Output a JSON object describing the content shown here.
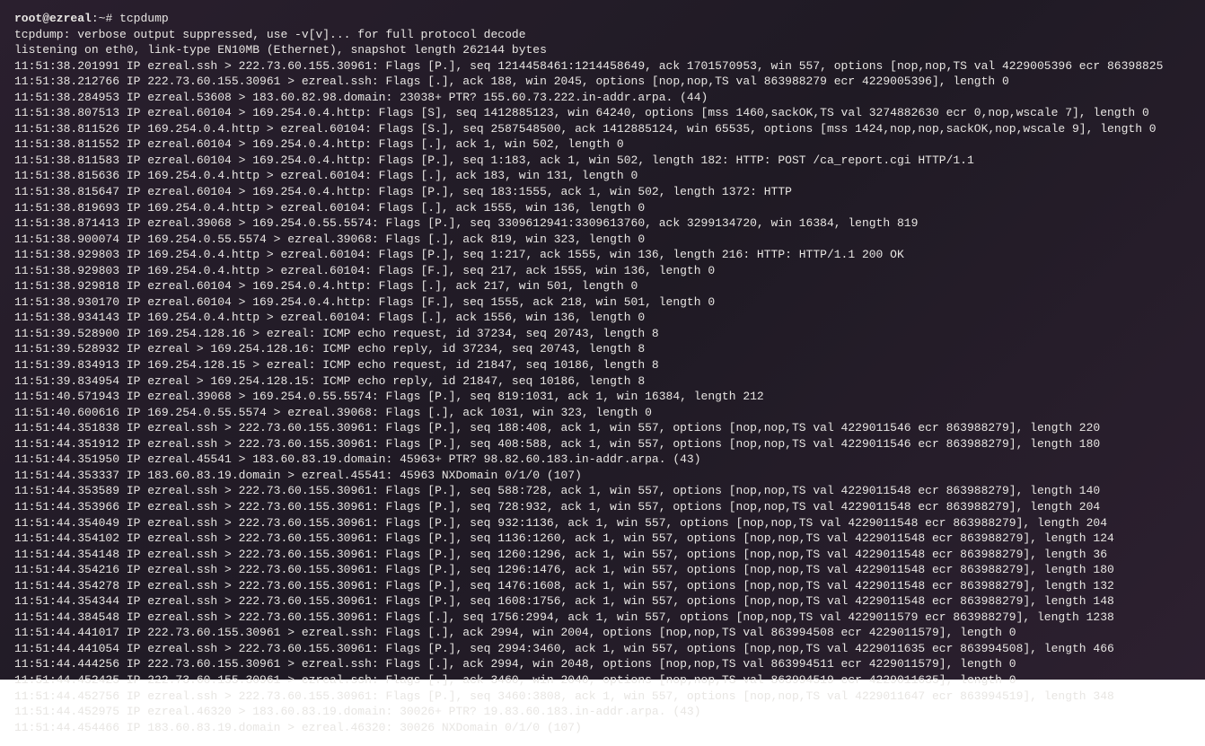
{
  "prompt": {
    "user_host": "root@ezreal",
    "separator": ":",
    "path": "~",
    "symbol": "#",
    "command": "tcpdump"
  },
  "lines": [
    "tcpdump: verbose output suppressed, use -v[v]... for full protocol decode",
    "listening on eth0, link-type EN10MB (Ethernet), snapshot length 262144 bytes",
    "11:51:38.201991 IP ezreal.ssh > 222.73.60.155.30961: Flags [P.], seq 1214458461:1214458649, ack 1701570953, win 557, options [nop,nop,TS val 4229005396 ecr 86398825",
    "11:51:38.212766 IP 222.73.60.155.30961 > ezreal.ssh: Flags [.], ack 188, win 2045, options [nop,nop,TS val 863988279 ecr 4229005396], length 0",
    "11:51:38.284953 IP ezreal.53608 > 183.60.82.98.domain: 23038+ PTR? 155.60.73.222.in-addr.arpa. (44)",
    "11:51:38.807513 IP ezreal.60104 > 169.254.0.4.http: Flags [S], seq 1412885123, win 64240, options [mss 1460,sackOK,TS val 3274882630 ecr 0,nop,wscale 7], length 0",
    "11:51:38.811526 IP 169.254.0.4.http > ezreal.60104: Flags [S.], seq 2587548500, ack 1412885124, win 65535, options [mss 1424,nop,nop,sackOK,nop,wscale 9], length 0",
    "11:51:38.811552 IP ezreal.60104 > 169.254.0.4.http: Flags [.], ack 1, win 502, length 0",
    "11:51:38.811583 IP ezreal.60104 > 169.254.0.4.http: Flags [P.], seq 1:183, ack 1, win 502, length 182: HTTP: POST /ca_report.cgi HTTP/1.1",
    "11:51:38.815636 IP 169.254.0.4.http > ezreal.60104: Flags [.], ack 183, win 131, length 0",
    "11:51:38.815647 IP ezreal.60104 > 169.254.0.4.http: Flags [P.], seq 183:1555, ack 1, win 502, length 1372: HTTP",
    "11:51:38.819693 IP 169.254.0.4.http > ezreal.60104: Flags [.], ack 1555, win 136, length 0",
    "11:51:38.871413 IP ezreal.39068 > 169.254.0.55.5574: Flags [P.], seq 3309612941:3309613760, ack 3299134720, win 16384, length 819",
    "11:51:38.900074 IP 169.254.0.55.5574 > ezreal.39068: Flags [.], ack 819, win 323, length 0",
    "11:51:38.929803 IP 169.254.0.4.http > ezreal.60104: Flags [P.], seq 1:217, ack 1555, win 136, length 216: HTTP: HTTP/1.1 200 OK",
    "11:51:38.929803 IP 169.254.0.4.http > ezreal.60104: Flags [F.], seq 217, ack 1555, win 136, length 0",
    "11:51:38.929818 IP ezreal.60104 > 169.254.0.4.http: Flags [.], ack 217, win 501, length 0",
    "11:51:38.930170 IP ezreal.60104 > 169.254.0.4.http: Flags [F.], seq 1555, ack 218, win 501, length 0",
    "11:51:38.934143 IP 169.254.0.4.http > ezreal.60104: Flags [.], ack 1556, win 136, length 0",
    "11:51:39.528900 IP 169.254.128.16 > ezreal: ICMP echo request, id 37234, seq 20743, length 8",
    "11:51:39.528932 IP ezreal > 169.254.128.16: ICMP echo reply, id 37234, seq 20743, length 8",
    "11:51:39.834913 IP 169.254.128.15 > ezreal: ICMP echo request, id 21847, seq 10186, length 8",
    "11:51:39.834954 IP ezreal > 169.254.128.15: ICMP echo reply, id 21847, seq 10186, length 8",
    "11:51:40.571943 IP ezreal.39068 > 169.254.0.55.5574: Flags [P.], seq 819:1031, ack 1, win 16384, length 212",
    "11:51:40.600616 IP 169.254.0.55.5574 > ezreal.39068: Flags [.], ack 1031, win 323, length 0",
    "11:51:44.351838 IP ezreal.ssh > 222.73.60.155.30961: Flags [P.], seq 188:408, ack 1, win 557, options [nop,nop,TS val 4229011546 ecr 863988279], length 220",
    "11:51:44.351912 IP ezreal.ssh > 222.73.60.155.30961: Flags [P.], seq 408:588, ack 1, win 557, options [nop,nop,TS val 4229011546 ecr 863988279], length 180",
    "11:51:44.351950 IP ezreal.45541 > 183.60.83.19.domain: 45963+ PTR? 98.82.60.183.in-addr.arpa. (43)",
    "11:51:44.353337 IP 183.60.83.19.domain > ezreal.45541: 45963 NXDomain 0/1/0 (107)",
    "11:51:44.353589 IP ezreal.ssh > 222.73.60.155.30961: Flags [P.], seq 588:728, ack 1, win 557, options [nop,nop,TS val 4229011548 ecr 863988279], length 140",
    "11:51:44.353966 IP ezreal.ssh > 222.73.60.155.30961: Flags [P.], seq 728:932, ack 1, win 557, options [nop,nop,TS val 4229011548 ecr 863988279], length 204",
    "11:51:44.354049 IP ezreal.ssh > 222.73.60.155.30961: Flags [P.], seq 932:1136, ack 1, win 557, options [nop,nop,TS val 4229011548 ecr 863988279], length 204",
    "11:51:44.354102 IP ezreal.ssh > 222.73.60.155.30961: Flags [P.], seq 1136:1260, ack 1, win 557, options [nop,nop,TS val 4229011548 ecr 863988279], length 124",
    "11:51:44.354148 IP ezreal.ssh > 222.73.60.155.30961: Flags [P.], seq 1260:1296, ack 1, win 557, options [nop,nop,TS val 4229011548 ecr 863988279], length 36",
    "11:51:44.354216 IP ezreal.ssh > 222.73.60.155.30961: Flags [P.], seq 1296:1476, ack 1, win 557, options [nop,nop,TS val 4229011548 ecr 863988279], length 180",
    "11:51:44.354278 IP ezreal.ssh > 222.73.60.155.30961: Flags [P.], seq 1476:1608, ack 1, win 557, options [nop,nop,TS val 4229011548 ecr 863988279], length 132",
    "11:51:44.354344 IP ezreal.ssh > 222.73.60.155.30961: Flags [P.], seq 1608:1756, ack 1, win 557, options [nop,nop,TS val 4229011548 ecr 863988279], length 148",
    "11:51:44.384548 IP ezreal.ssh > 222.73.60.155.30961: Flags [.], seq 1756:2994, ack 1, win 557, options [nop,nop,TS val 4229011579 ecr 863988279], length 1238",
    "11:51:44.441017 IP 222.73.60.155.30961 > ezreal.ssh: Flags [.], ack 2994, win 2004, options [nop,nop,TS val 863994508 ecr 4229011579], length 0",
    "11:51:44.441054 IP ezreal.ssh > 222.73.60.155.30961: Flags [P.], seq 2994:3460, ack 1, win 557, options [nop,nop,TS val 4229011635 ecr 863994508], length 466",
    "11:51:44.444256 IP 222.73.60.155.30961 > ezreal.ssh: Flags [.], ack 2994, win 2048, options [nop,nop,TS val 863994511 ecr 4229011579], length 0",
    "11:51:44.452425 IP 222.73.60.155.30961 > ezreal.ssh: Flags [.], ack 3460, win 2040, options [nop,nop,TS val 863994519 ecr 4229011635], length 0",
    "11:51:44.452756 IP ezreal.ssh > 222.73.60.155.30961: Flags [P.], seq 3460:3808, ack 1, win 557, options [nop,nop,TS val 4229011647 ecr 863994519], length 348",
    "11:51:44.452975 IP ezreal.46320 > 183.60.83.19.domain: 30026+ PTR? 19.83.60.183.in-addr.arpa. (43)",
    "11:51:44.454466 IP 183.60.83.19.domain > ezreal.46320: 30026 NXDomain 0/1/0 (107)"
  ]
}
